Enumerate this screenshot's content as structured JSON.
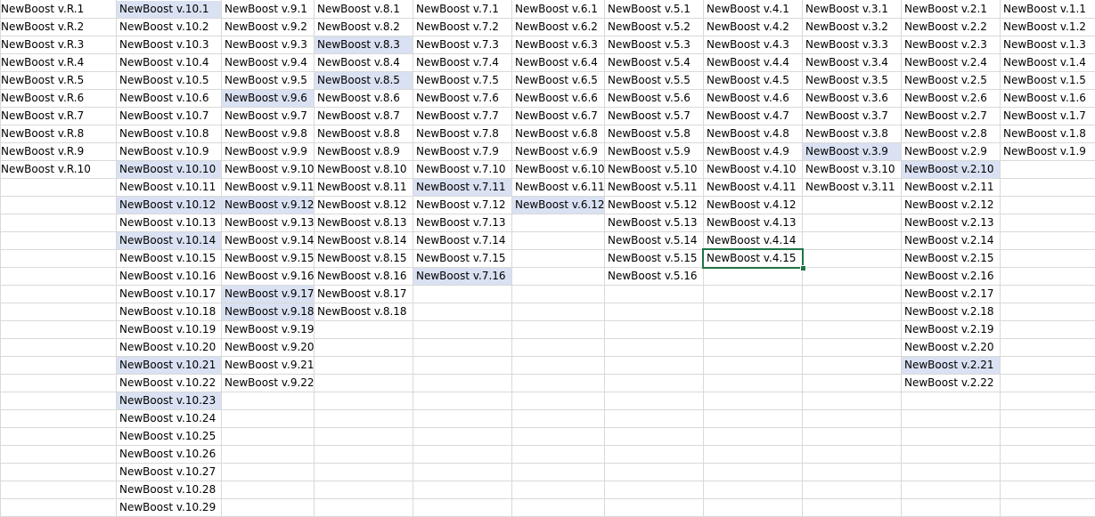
{
  "sheet": {
    "columns": [
      [
        "NewBoost v.R.1",
        "NewBoost v.R.2",
        "NewBoost v.R.3",
        "NewBoost v.R.4",
        "NewBoost v.R.5",
        "NewBoost v.R.6",
        "NewBoost v.R.7",
        "NewBoost v.R.8",
        "NewBoost v.R.9",
        "NewBoost v.R.10"
      ],
      [
        "NewBoost v.10.1",
        "NewBoost v.10.2",
        "NewBoost v.10.3",
        "NewBoost v.10.4",
        "NewBoost v.10.5",
        "NewBoost v.10.6",
        "NewBoost v.10.7",
        "NewBoost v.10.8",
        "NewBoost v.10.9",
        "NewBoost v.10.10",
        "NewBoost v.10.11",
        "NewBoost v.10.12",
        "NewBoost v.10.13",
        "NewBoost v.10.14",
        "NewBoost v.10.15",
        "NewBoost v.10.16",
        "NewBoost v.10.17",
        "NewBoost v.10.18",
        "NewBoost v.10.19",
        "NewBoost v.10.20",
        "NewBoost v.10.21",
        "NewBoost v.10.22",
        "NewBoost v.10.23",
        "NewBoost v.10.24",
        "NewBoost v.10.25",
        "NewBoost v.10.26",
        "NewBoost v.10.27",
        "NewBoost v.10.28",
        "NewBoost v.10.29"
      ],
      [
        "NewBoost v.9.1",
        "NewBoost v.9.2",
        "NewBoost v.9.3",
        "NewBoost v.9.4",
        "NewBoost v.9.5",
        "NewBoost v.9.6",
        "NewBoost v.9.7",
        "NewBoost v.9.8",
        "NewBoost v.9.9",
        "NewBoost v.9.10",
        "NewBoost v.9.11",
        "NewBoost v.9.12",
        "NewBoost v.9.13",
        "NewBoost v.9.14",
        "NewBoost v.9.15",
        "NewBoost v.9.16",
        "NewBoost v.9.17",
        "NewBoost v.9.18",
        "NewBoost v.9.19",
        "NewBoost v.9.20",
        "NewBoost v.9.21",
        "NewBoost v.9.22"
      ],
      [
        "NewBoost v.8.1",
        "NewBoost v.8.2",
        "NewBoost v.8.3",
        "NewBoost v.8.4",
        "NewBoost v.8.5",
        "NewBoost v.8.6",
        "NewBoost v.8.7",
        "NewBoost v.8.8",
        "NewBoost v.8.9",
        "NewBoost v.8.10",
        "NewBoost v.8.11",
        "NewBoost v.8.12",
        "NewBoost v.8.13",
        "NewBoost v.8.14",
        "NewBoost v.8.15",
        "NewBoost v.8.16",
        "NewBoost v.8.17",
        "NewBoost v.8.18"
      ],
      [
        "NewBoost v.7.1",
        "NewBoost v.7.2",
        "NewBoost v.7.3",
        "NewBoost v.7.4",
        "NewBoost v.7.5",
        "NewBoost v.7.6",
        "NewBoost v.7.7",
        "NewBoost v.7.8",
        "NewBoost v.7.9",
        "NewBoost v.7.10",
        "NewBoost v.7.11",
        "NewBoost v.7.12",
        "NewBoost v.7.13",
        "NewBoost v.7.14",
        "NewBoost v.7.15",
        "NewBoost v.7.16"
      ],
      [
        "NewBoost v.6.1",
        "NewBoost v.6.2",
        "NewBoost v.6.3",
        "NewBoost v.6.4",
        "NewBoost v.6.5",
        "NewBoost v.6.6",
        "NewBoost v.6.7",
        "NewBoost v.6.8",
        "NewBoost v.6.9",
        "NewBoost v.6.10",
        "NewBoost v.6.11",
        "NewBoost v.6.12"
      ],
      [
        "NewBoost v.5.1",
        "NewBoost v.5.2",
        "NewBoost v.5.3",
        "NewBoost v.5.4",
        "NewBoost v.5.5",
        "NewBoost v.5.6",
        "NewBoost v.5.7",
        "NewBoost v.5.8",
        "NewBoost v.5.9",
        "NewBoost v.5.10",
        "NewBoost v.5.11",
        "NewBoost v.5.12",
        "NewBoost v.5.13",
        "NewBoost v.5.14",
        "NewBoost v.5.15",
        "NewBoost v.5.16"
      ],
      [
        "NewBoost v.4.1",
        "NewBoost v.4.2",
        "NewBoost v.4.3",
        "NewBoost v.4.4",
        "NewBoost v.4.5",
        "NewBoost v.4.6",
        "NewBoost v.4.7",
        "NewBoost v.4.8",
        "NewBoost v.4.9",
        "NewBoost v.4.10",
        "NewBoost v.4.11",
        "NewBoost v.4.12",
        "NewBoost v.4.13",
        "NewBoost v.4.14",
        "NewBoost v.4.15"
      ],
      [
        "NewBoost v.3.1",
        "NewBoost v.3.2",
        "NewBoost v.3.3",
        "NewBoost v.3.4",
        "NewBoost v.3.5",
        "NewBoost v.3.6",
        "NewBoost v.3.7",
        "NewBoost v.3.8",
        "NewBoost v.3.9",
        "NewBoost v.3.10",
        "NewBoost v.3.11"
      ],
      [
        "NewBoost v.2.1",
        "NewBoost v.2.2",
        "NewBoost v.2.3",
        "NewBoost v.2.4",
        "NewBoost v.2.5",
        "NewBoost v.2.6",
        "NewBoost v.2.7",
        "NewBoost v.2.8",
        "NewBoost v.2.9",
        "NewBoost v.2.10",
        "NewBoost v.2.11",
        "NewBoost v.2.12",
        "NewBoost v.2.13",
        "NewBoost v.2.14",
        "NewBoost v.2.15",
        "NewBoost v.2.16",
        "NewBoost v.2.17",
        "NewBoost v.2.18",
        "NewBoost v.2.19",
        "NewBoost v.2.20",
        "NewBoost v.2.21",
        "NewBoost v.2.22"
      ],
      [
        "NewBoost v.1.1",
        "NewBoost v.1.2",
        "NewBoost v.1.3",
        "NewBoost v.1.4",
        "NewBoost v.1.5",
        "NewBoost v.1.6",
        "NewBoost v.1.7",
        "NewBoost v.1.8",
        "NewBoost v.1.9"
      ]
    ],
    "highlighted_cells": [
      [
        1,
        0
      ],
      [
        1,
        9
      ],
      [
        1,
        11
      ],
      [
        1,
        13
      ],
      [
        1,
        20
      ],
      [
        1,
        22
      ],
      [
        2,
        5
      ],
      [
        2,
        11
      ],
      [
        2,
        16
      ],
      [
        2,
        17
      ],
      [
        3,
        2
      ],
      [
        3,
        4
      ],
      [
        4,
        10
      ],
      [
        4,
        15
      ],
      [
        5,
        11
      ],
      [
        8,
        8
      ],
      [
        9,
        9
      ],
      [
        9,
        20
      ]
    ],
    "active_cell": [
      7,
      14
    ],
    "colors": {
      "highlight": "#d9e1f2",
      "gridline": "#d9d9d9",
      "selection": "#217346",
      "text": "#000000"
    }
  }
}
